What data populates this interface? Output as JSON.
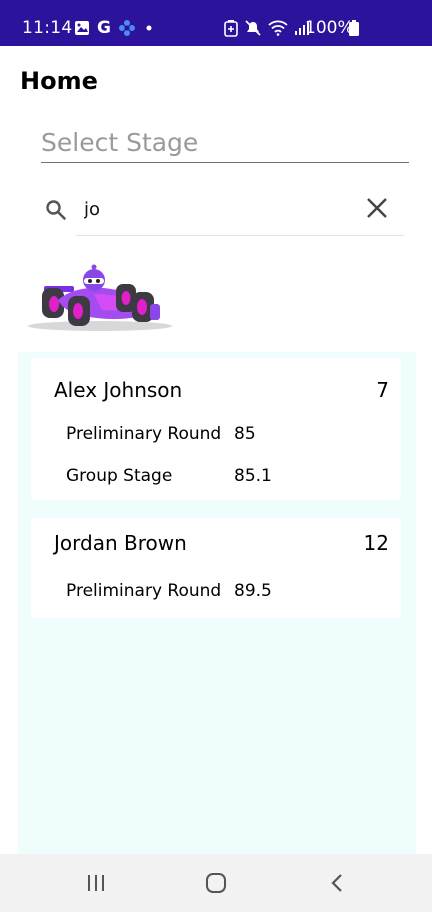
{
  "status_bar": {
    "time": "11:14",
    "left_icons": [
      "image-icon",
      "google-icon",
      "flower-icon",
      "dot-icon"
    ],
    "right_icons": [
      "battery-saver-icon",
      "mute-icon",
      "wifi-icon",
      "signal-icon",
      "battery-icon"
    ],
    "battery_percent": "100%",
    "background_color": "#2d139c"
  },
  "header": {
    "title": "Home"
  },
  "stage_select": {
    "placeholder": "Select Stage"
  },
  "search": {
    "value": "jo",
    "placeholder": ""
  },
  "results": {
    "background_color": "#f0fdfd",
    "cards": [
      {
        "name": "Alex Johnson",
        "count": "7",
        "rounds": [
          {
            "round": "Preliminary Round",
            "score": "85"
          },
          {
            "round": "Group Stage",
            "score": "85.1"
          }
        ]
      },
      {
        "name": "Jordan Brown",
        "count": "12",
        "rounds": [
          {
            "round": "Preliminary Round",
            "score": "89.5"
          }
        ]
      }
    ]
  },
  "nav_bar": {
    "buttons": [
      "recent-apps-icon",
      "home-icon",
      "back-icon"
    ]
  }
}
